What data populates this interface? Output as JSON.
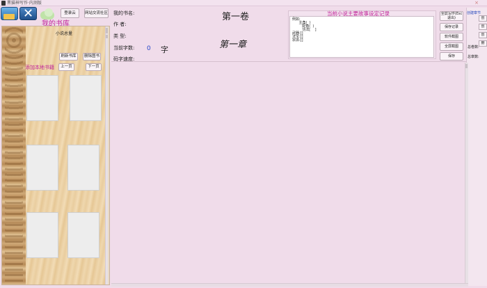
{
  "window": {
    "title": "黑猫神写作·内测版",
    "close_symbol": "×"
  },
  "toolbar": {
    "login_label": "登录云",
    "community_label": "网站交流社区"
  },
  "library": {
    "title": "我的书库",
    "total_label": "小说总量",
    "refresh_label": "刷新书库",
    "delete_label": "删除图书",
    "add_local_label": "添加本地书籍",
    "prev_label": "上一页",
    "next_label": "下一页",
    "books": [
      "",
      "",
      "",
      "",
      "",
      ""
    ]
  },
  "info": {
    "book_name_label": "我的书名:",
    "author_label": "作    者:",
    "type_label": "类    型:",
    "word_count_label": "当前字数:",
    "word_count_value": "0",
    "word_unit": "字",
    "speed_label": "码字速度:"
  },
  "editor": {
    "volume_title": "第一卷",
    "chapter_title": "第一章"
  },
  "record": {
    "title": "当前小说主要故事设定记录",
    "lines": [
      "例如:",
      "      主角(  )",
      "         配角(  )",
      "         功法[    ]",
      "武器:[]",
      "法宝:[]",
      "宗派:[]"
    ]
  },
  "actions": {
    "fullscreen_label": "全屏写作(Esc退出)",
    "save_record_label": "保存记录",
    "software_screenshot_label": "软件截图",
    "full_screenshot_label": "全屏截图",
    "save_label": "保存"
  },
  "right_panel": {
    "create_chapter_tab": "创建章节",
    "btn1": "创",
    "btn2": "创",
    "btn3": "创",
    "btn4": "删",
    "total_count_label": "总卷数:",
    "total_chapters_label": "总章数:"
  }
}
